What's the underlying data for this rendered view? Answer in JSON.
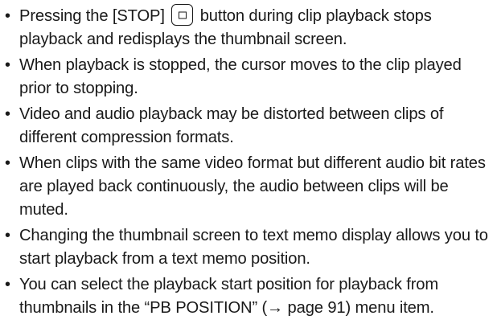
{
  "notes": {
    "bullet": "•",
    "items": [
      {
        "before_icon": "Pressing the [STOP]",
        "icon": "stop-icon",
        "after_icon": "button during clip playback stops playback and redisplays the thumbnail screen."
      },
      {
        "text": "When playback is stopped, the cursor moves to the clip played prior to stopping."
      },
      {
        "text": "Video and audio playback may be distorted between clips of different compression formats."
      },
      {
        "text": "When clips with the same video format but different audio bit rates are played back continuously, the audio between clips will be muted."
      },
      {
        "text": "Changing the thumbnail screen to text memo display allows you to start playback from a text memo position."
      },
      {
        "text": "You can select the playback start position for playback from thumbnails in the “PB POSITION” (→ page 91) menu item."
      }
    ]
  }
}
